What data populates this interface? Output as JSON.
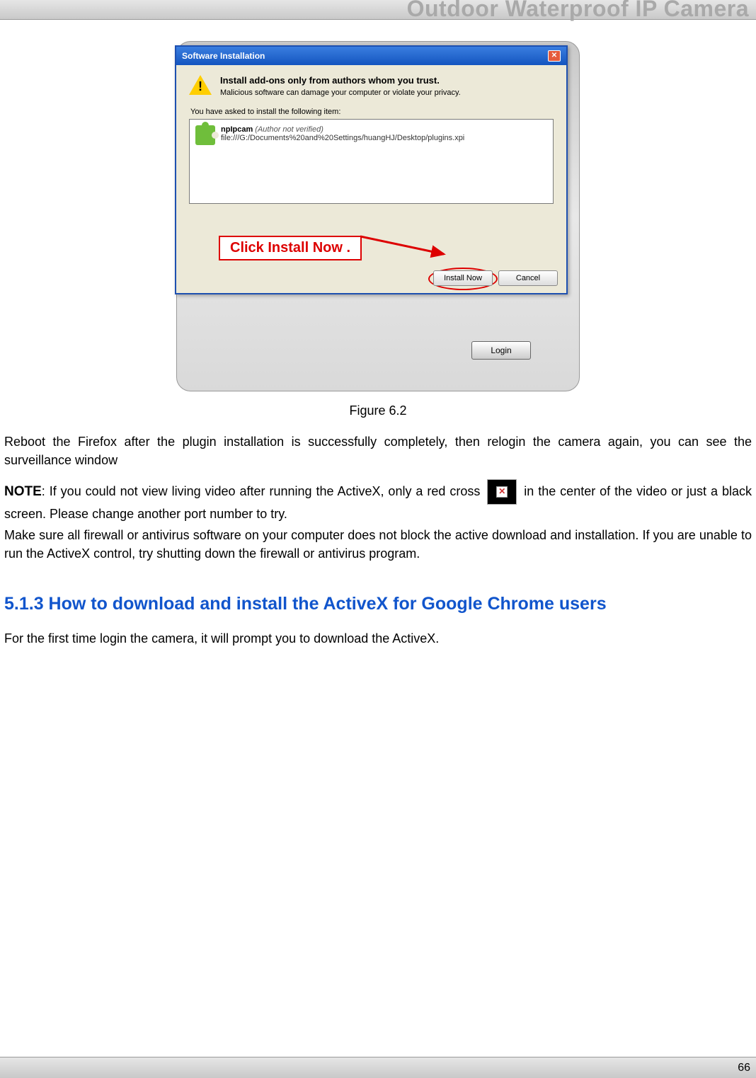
{
  "header": {
    "title": "Outdoor Waterproof IP Camera"
  },
  "dialog": {
    "title": "Software Installation",
    "trust_line": "Install add-ons only from authors whom you trust.",
    "malware_line": "Malicious software can damage your computer or violate your privacy.",
    "asked_line": "You have asked to install the following item:",
    "item_name": "npIpcam",
    "item_author": "(Author not verified)",
    "item_path": "file:///G:/Documents%20and%20Settings/huangHJ/Desktop/plugins.xpi",
    "install_btn": "Install Now",
    "cancel_btn": "Cancel"
  },
  "callout": {
    "text": "Click Install Now ."
  },
  "background_panel": {
    "login_btn": "Login"
  },
  "figure_caption": "Figure 6.2",
  "paragraphs": {
    "reboot": "Reboot the Firefox after the plugin installation is successfully completely, then relogin the camera again, you can see the surveillance window",
    "note_label": "NOTE",
    "note_part1": ": If you could not view living video after running the ActiveX, only a red cross",
    "note_part2": "in the center of the video or just a black screen. Please change another port number to try.",
    "firewall": "Make sure all firewall or antivirus software on your computer does not block the active download and installation. If you are unable to run the ActiveX control, try shutting down the firewall or antivirus program."
  },
  "section_heading": "5.1.3 How to download and install the ActiveX for Google Chrome users",
  "chrome_para": "For the first time login the camera, it will prompt you to download the ActiveX.",
  "page_number": "66"
}
